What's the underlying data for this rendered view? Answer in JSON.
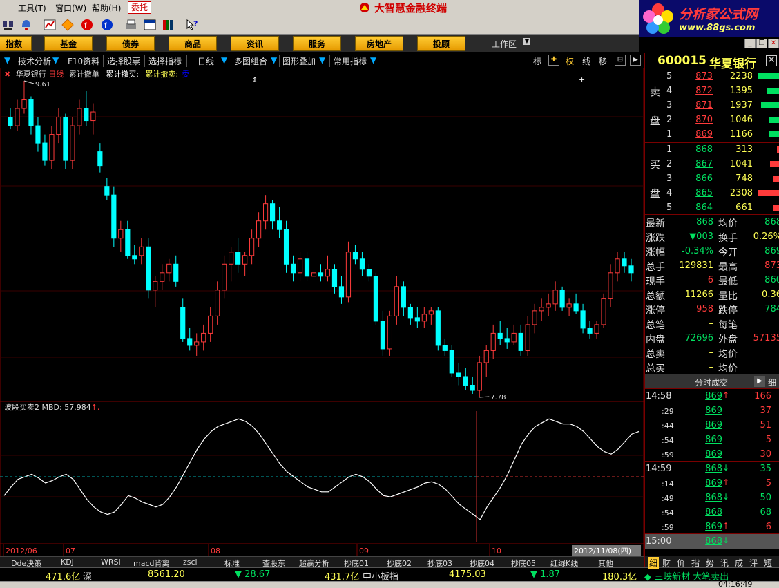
{
  "menu": {
    "tools": "工具(T)",
    "window": "窗口(W)",
    "help": "帮助(H)",
    "entrust": "委托",
    "app_title": "大智慧金融终端"
  },
  "brand": {
    "line1": "分析家公式网",
    "line2": "www.88gs.com"
  },
  "nav": {
    "items": [
      "指数",
      "基金",
      "债券",
      "商品",
      "资讯",
      "服务",
      "房地产",
      "投顾"
    ],
    "workarea": "工作区"
  },
  "funcbar": {
    "tech": "技术分析",
    "f10": "F10资料",
    "pick_stock": "选择股票",
    "pick_ind": "选择指标",
    "period": "日线",
    "multi": "多图组合",
    "overlay": "图形叠加",
    "common_ind": "常用指标",
    "btn_biao": "标",
    "btn_quan": "权",
    "btn_xian": "线",
    "btn_yi": "移"
  },
  "chart": {
    "stock_name": "华夏银行",
    "period": "日线",
    "legend1": "累计撤单",
    "legend2": "累计撤买:",
    "legend3": "累计撤卖:",
    "legend3_val": "委",
    "high_label": "9.61",
    "low_label": "7.78",
    "indicator": "波段买卖2 MBD: 57.984",
    "indicator_arrow": "↑,",
    "x_labels": [
      "2012/06",
      "07",
      "08",
      "09",
      "10"
    ],
    "cur_date": "2012/11/08(四)"
  },
  "chart_data": {
    "type": "candlestick",
    "price_high": 9.61,
    "price_low": 7.78,
    "candles": [
      [
        9.4,
        9.45,
        9.33,
        9.35
      ],
      [
        9.35,
        9.5,
        9.32,
        9.45
      ],
      [
        9.45,
        9.61,
        9.42,
        9.5
      ],
      [
        9.5,
        9.52,
        9.3,
        9.35
      ],
      [
        9.35,
        9.4,
        9.2,
        9.25
      ],
      [
        9.25,
        9.3,
        9.12,
        9.15
      ],
      [
        9.15,
        9.35,
        9.1,
        9.3
      ],
      [
        9.3,
        9.45,
        9.25,
        9.4
      ],
      [
        9.4,
        9.42,
        9.1,
        9.15
      ],
      [
        9.15,
        9.4,
        9.1,
        9.35
      ],
      [
        9.35,
        9.5,
        9.3,
        9.45
      ],
      [
        9.45,
        9.55,
        9.35,
        9.38
      ],
      [
        9.38,
        9.48,
        9.3,
        9.43
      ],
      [
        9.2,
        9.25,
        9.08,
        9.12
      ],
      [
        9.0,
        9.05,
        8.92,
        8.95
      ],
      [
        8.95,
        9.0,
        8.65,
        8.7
      ],
      [
        8.7,
        8.8,
        8.62,
        8.75
      ],
      [
        8.75,
        8.8,
        8.58,
        8.6
      ],
      [
        8.6,
        8.66,
        8.55,
        8.58
      ],
      [
        8.6,
        8.7,
        8.55,
        8.65
      ],
      [
        8.65,
        8.7,
        8.35,
        8.4
      ],
      [
        8.4,
        8.48,
        8.3,
        8.45
      ],
      [
        8.45,
        8.55,
        8.4,
        8.5
      ],
      [
        8.5,
        8.58,
        8.45,
        8.55
      ],
      [
        8.55,
        8.6,
        8.42,
        8.45
      ],
      [
        8.3,
        8.35,
        8.1,
        8.12
      ],
      [
        8.12,
        8.18,
        8.05,
        8.08
      ],
      [
        8.08,
        8.15,
        8.02,
        8.1
      ],
      [
        8.1,
        8.2,
        8.05,
        8.15
      ],
      [
        8.15,
        8.3,
        8.1,
        8.25
      ],
      [
        8.25,
        8.45,
        8.2,
        8.4
      ],
      [
        8.4,
        8.6,
        8.35,
        8.55
      ],
      [
        8.55,
        8.65,
        8.45,
        8.62
      ],
      [
        8.62,
        8.7,
        8.5,
        8.55
      ],
      [
        8.55,
        8.62,
        8.48,
        8.6
      ],
      [
        8.6,
        8.75,
        8.55,
        8.7
      ],
      [
        8.7,
        8.85,
        8.65,
        8.8
      ],
      [
        8.8,
        8.95,
        8.75,
        8.9
      ],
      [
        8.9,
        8.92,
        8.75,
        8.8
      ],
      [
        8.8,
        8.88,
        8.7,
        8.75
      ],
      [
        8.75,
        8.8,
        8.5,
        8.55
      ],
      [
        8.55,
        8.6,
        8.45,
        8.5
      ],
      [
        8.5,
        8.62,
        8.45,
        8.58
      ],
      [
        8.58,
        8.62,
        8.45,
        8.48
      ],
      [
        8.48,
        8.55,
        8.42,
        8.5
      ],
      [
        8.5,
        8.55,
        8.45,
        8.48
      ],
      [
        8.48,
        8.6,
        8.45,
        8.52
      ],
      [
        8.52,
        8.55,
        8.38,
        8.42
      ],
      [
        8.42,
        8.48,
        8.32,
        8.36
      ],
      [
        8.36,
        8.68,
        8.33,
        8.62
      ],
      [
        8.62,
        8.66,
        8.55,
        8.58
      ],
      [
        8.58,
        8.62,
        8.48,
        8.52
      ],
      [
        8.52,
        8.55,
        8.45,
        8.48
      ],
      [
        8.48,
        8.5,
        8.2,
        8.22
      ],
      [
        8.22,
        8.28,
        8.02,
        8.06
      ],
      [
        8.06,
        8.28,
        8.02,
        8.25
      ],
      [
        8.25,
        8.48,
        8.2,
        8.42
      ],
      [
        8.42,
        8.45,
        8.25,
        8.3
      ],
      [
        8.3,
        8.32,
        8.2,
        8.24
      ],
      [
        8.24,
        8.3,
        8.18,
        8.22
      ],
      [
        8.22,
        8.3,
        8.18,
        8.26
      ],
      [
        8.26,
        8.3,
        8.2,
        8.28
      ],
      [
        8.28,
        8.3,
        8.05,
        8.08
      ],
      [
        8.08,
        8.12,
        8.02,
        8.05
      ],
      [
        8.05,
        8.08,
        7.9,
        7.92
      ],
      [
        7.92,
        7.98,
        7.85,
        7.9
      ],
      [
        7.9,
        7.95,
        7.82,
        7.85
      ],
      [
        7.85,
        7.9,
        7.8,
        7.82
      ],
      [
        7.82,
        8.02,
        7.78,
        7.98
      ],
      [
        7.98,
        8.08,
        7.9,
        8.05
      ],
      [
        8.05,
        8.2,
        8.0,
        8.15
      ],
      [
        8.15,
        8.22,
        8.08,
        8.12
      ],
      [
        8.12,
        8.18,
        8.06,
        8.1
      ],
      [
        8.1,
        8.2,
        8.08,
        8.15
      ],
      [
        8.15,
        8.2,
        8.02,
        8.05
      ],
      [
        8.05,
        8.25,
        8.02,
        8.2
      ],
      [
        8.2,
        8.32,
        8.15,
        8.28
      ],
      [
        8.28,
        8.35,
        8.22,
        8.3
      ],
      [
        8.3,
        8.38,
        8.25,
        8.32
      ],
      [
        8.32,
        8.45,
        8.28,
        8.4
      ],
      [
        8.4,
        8.42,
        8.28,
        8.3
      ],
      [
        8.3,
        8.35,
        8.25,
        8.32
      ],
      [
        8.32,
        8.38,
        8.26,
        8.28
      ],
      [
        8.28,
        8.32,
        8.15,
        8.18
      ],
      [
        8.18,
        8.22,
        8.12,
        8.15
      ],
      [
        8.15,
        8.22,
        8.12,
        8.2
      ],
      [
        8.2,
        8.38,
        8.18,
        8.35
      ],
      [
        8.35,
        8.55,
        8.3,
        8.5
      ],
      [
        8.5,
        8.62,
        8.45,
        8.58
      ],
      [
        8.58,
        8.62,
        8.5,
        8.54
      ],
      [
        8.54,
        8.58,
        8.45,
        8.5
      ]
    ],
    "indicator": {
      "name": "波段买卖2 MBD",
      "value": 57.984,
      "series": [
        35,
        42,
        48,
        50,
        52,
        49,
        45,
        47,
        50,
        52,
        48,
        40,
        32,
        26,
        22,
        20,
        22,
        28,
        35,
        33,
        30,
        28,
        26,
        28,
        34,
        42,
        52,
        62,
        72,
        80,
        86,
        90,
        92,
        94,
        96,
        94,
        90,
        84,
        76,
        68,
        60,
        54,
        50,
        46,
        42,
        40,
        38,
        38,
        42,
        46,
        50,
        52,
        50,
        46,
        40,
        35,
        34,
        36,
        38,
        40,
        42,
        45,
        46,
        44,
        40,
        34,
        28,
        24,
        20,
        16,
        26,
        34,
        42,
        52,
        64,
        76,
        84,
        90,
        93,
        96,
        94,
        92,
        92,
        90,
        86,
        80,
        74,
        70,
        68,
        72,
        78,
        84,
        86
      ]
    }
  },
  "quote": {
    "code": "600015",
    "name": "华夏银行",
    "sell_label": [
      "卖",
      "盘"
    ],
    "buy_label": [
      "买",
      "盘"
    ],
    "sells": [
      {
        "lv": "5",
        "price": "873",
        "vol": "2238"
      },
      {
        "lv": "4",
        "price": "872",
        "vol": "1395"
      },
      {
        "lv": "3",
        "price": "871",
        "vol": "1937"
      },
      {
        "lv": "2",
        "price": "870",
        "vol": "1046"
      },
      {
        "lv": "1",
        "price": "869",
        "vol": "1166"
      }
    ],
    "buys": [
      {
        "lv": "1",
        "price": "868",
        "vol": "313"
      },
      {
        "lv": "2",
        "price": "867",
        "vol": "1041"
      },
      {
        "lv": "3",
        "price": "866",
        "vol": "748"
      },
      {
        "lv": "4",
        "price": "865",
        "vol": "2308"
      },
      {
        "lv": "5",
        "price": "864",
        "vol": "661"
      }
    ],
    "stats": [
      {
        "l1": "最新",
        "v1": "868",
        "c1": "#00e060",
        "l2": "均价",
        "v2": "868",
        "c2": "#00e060"
      },
      {
        "l1": "涨跌",
        "v1": "▼003",
        "c1": "#00e060",
        "l2": "换手",
        "v2": "0.26%",
        "c2": "#ffff55"
      },
      {
        "l1": "涨幅",
        "v1": "-0.34%",
        "c1": "#00e060",
        "l2": "今开",
        "v2": "869",
        "c2": "#00e060"
      },
      {
        "l1": "总手",
        "v1": "129831",
        "c1": "#ffff55",
        "l2": "最高",
        "v2": "873",
        "c2": "#ff3b3b"
      },
      {
        "l1": "现手",
        "v1": "6",
        "c1": "#ff3b3b",
        "l2": "最低",
        "v2": "860",
        "c2": "#00e060"
      },
      {
        "l1": "总额",
        "v1": "11266",
        "c1": "#ffff55",
        "l2": "量比",
        "v2": "0.36",
        "c2": "#ffff55"
      },
      {
        "l1": "涨停",
        "v1": "958",
        "c1": "#ff3b3b",
        "l2": "跌停",
        "v2": "784",
        "c2": "#00e060"
      },
      {
        "l1": "总笔",
        "v1": "–",
        "c1": "#ffff55",
        "l2": "每笔",
        "v2": "",
        "c2": "#ffff55"
      },
      {
        "l1": "内盘",
        "v1": "72696",
        "c1": "#00e060",
        "l2": "外盘",
        "v2": "57135",
        "c2": "#ff3b3b"
      },
      {
        "l1": "总卖",
        "v1": "–",
        "c1": "#ffff55",
        "l2": "均价",
        "v2": "",
        "c2": "#ffff55"
      },
      {
        "l1": "总买",
        "v1": "–",
        "c1": "#ffff55",
        "l2": "均价",
        "v2": "",
        "c2": "#ffff55"
      }
    ],
    "ticks_title": "分时成交",
    "ticks_tab": "细",
    "ticks": [
      {
        "t": "14:58",
        "small": false,
        "p": "869",
        "a": "↑",
        "ac": "#ff3b3b",
        "v": "166"
      },
      {
        "t": ":29",
        "small": true,
        "p": "869",
        "a": "",
        "ac": "#ff3b3b",
        "v": "37"
      },
      {
        "t": ":44",
        "small": true,
        "p": "869",
        "a": "",
        "ac": "#ff3b3b",
        "v": "51"
      },
      {
        "t": ":54",
        "small": true,
        "p": "869",
        "a": "",
        "ac": "#ff3b3b",
        "v": "5"
      },
      {
        "t": ":59",
        "small": true,
        "p": "869",
        "a": "",
        "ac": "#ff3b3b",
        "v": "30"
      },
      {
        "t": "14:59",
        "small": false,
        "p": "868",
        "a": "↓",
        "ac": "#00e060",
        "v": "35"
      },
      {
        "t": ":14",
        "small": true,
        "p": "869",
        "a": "↑",
        "ac": "#ff3b3b",
        "v": "5"
      },
      {
        "t": ":49",
        "small": true,
        "p": "868",
        "a": "↓",
        "ac": "#00e060",
        "v": "50"
      },
      {
        "t": ":54",
        "small": true,
        "p": "868",
        "a": "",
        "ac": "#00e060",
        "v": "68"
      },
      {
        "t": ":59",
        "small": true,
        "p": "869",
        "a": "↑",
        "ac": "#ff3b3b",
        "v": "6"
      },
      {
        "t": "15:00",
        "small": false,
        "p": "868",
        "a": "↓",
        "ac": "#00e060",
        "v": ""
      }
    ],
    "right_tabs": [
      "细",
      "财",
      "价",
      "指",
      "势",
      "讯",
      "成",
      "评",
      "短"
    ]
  },
  "bottom_tabs": [
    "Dde决策",
    "KDJ",
    "WRSI",
    "macd背离",
    "zscl",
    "标准",
    "查股东",
    "超赢分析",
    "抄底01",
    "抄底02",
    "抄底03",
    "抄底04",
    "抄底05",
    "红绿K线",
    "其他"
  ],
  "status": {
    "sh_amount": "471.6亿",
    "sz_label": "深",
    "sz_index": "8561.20",
    "sz_change": "▼ 28.67",
    "sz_amount": "431.7亿",
    "sme_label": "中小板指",
    "sme_index": "4175.03",
    "sme_change": "▼ 1.87",
    "sme_amount": "180.3亿",
    "news": "◆ 三峡新材 大笔卖出",
    "time": "04:16:49"
  },
  "colors": {
    "up": "#ff3b3b",
    "down": "#00ffff",
    "grid": "#7a0000",
    "accent": "#ffcc33"
  }
}
